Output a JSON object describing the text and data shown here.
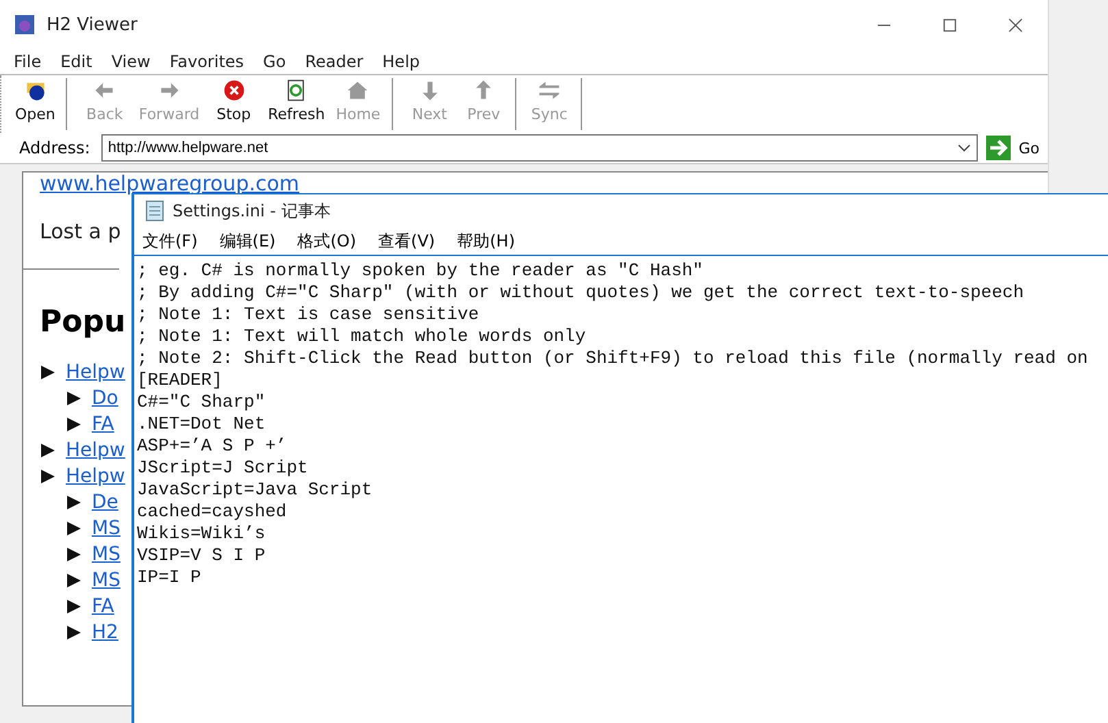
{
  "window": {
    "title": "H2 Viewer"
  },
  "menu": [
    "File",
    "Edit",
    "View",
    "Favorites",
    "Go",
    "Reader",
    "Help"
  ],
  "toolbar": [
    {
      "kind": "open",
      "label": "Open",
      "disabled": false,
      "separator_after": true
    },
    {
      "kind": "back",
      "label": "Back",
      "disabled": true,
      "separator_after": false
    },
    {
      "kind": "forward",
      "label": "Forward",
      "disabled": true,
      "separator_after": false
    },
    {
      "kind": "stop",
      "label": "Stop",
      "disabled": false,
      "separator_after": false
    },
    {
      "kind": "refresh",
      "label": "Refresh",
      "disabled": false,
      "separator_after": false
    },
    {
      "kind": "home",
      "label": "Home",
      "disabled": true,
      "separator_after": true
    },
    {
      "kind": "next",
      "label": "Next",
      "disabled": true,
      "separator_after": false
    },
    {
      "kind": "prev",
      "label": "Prev",
      "disabled": true,
      "separator_after": true
    },
    {
      "kind": "sync",
      "label": "Sync",
      "disabled": true,
      "separator_after": true
    }
  ],
  "address": {
    "label": "Address:",
    "value": "http://www.helpware.net",
    "go": "Go"
  },
  "page": {
    "link": "www.helpwaregroup.com",
    "text": "Lost a p",
    "heading": "Popu",
    "tree": [
      {
        "label": "Helpw",
        "children": [
          {
            "label": "Do"
          },
          {
            "label": "FA"
          }
        ]
      },
      {
        "label": "Helpw"
      },
      {
        "label": "Helpw",
        "children": [
          {
            "label": "De"
          },
          {
            "label": "MS"
          },
          {
            "label": "MS"
          },
          {
            "label": "MS"
          },
          {
            "label": "FA"
          },
          {
            "label": "H2"
          }
        ]
      }
    ]
  },
  "notepad": {
    "title": "Settings.ini - 记事本",
    "menu": [
      "文件(F)",
      "编辑(E)",
      "格式(O)",
      "查看(V)",
      "帮助(H)"
    ],
    "lines": [
      "; eg. C# is normally spoken by the reader as ″C Hash″",
      "; By adding C#=″C Sharp″ (with or without quotes) we get the correct text-to-speech",
      "; Note 1: Text is case sensitive",
      "; Note 1: Text will match whole words only",
      "; Note 2: Shift-Click the Read button (or Shift+F9) to reload this file (normally read on",
      "[READER]",
      "C#=″C Sharp″",
      ".NET=Dot Net",
      "ASP+=’A S P +’",
      "JScript=J Script",
      "JavaScript=Java Script",
      "cached=cayshed",
      "Wikis=Wiki’s",
      "VSIP=V S I P",
      "IP=I P"
    ]
  }
}
